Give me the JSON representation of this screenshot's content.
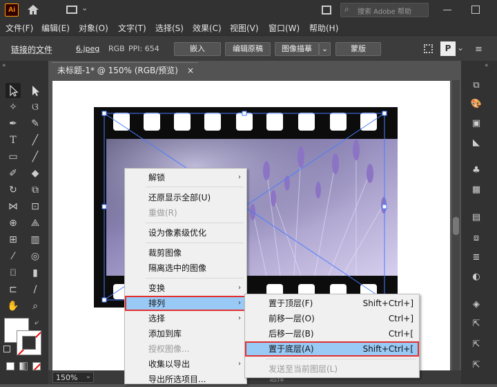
{
  "app": {
    "logo": "Ai",
    "search_placeholder": "搜索 Adobe 帮助"
  },
  "menu": [
    "文件(F)",
    "编辑(E)",
    "对象(O)",
    "文字(T)",
    "选择(S)",
    "效果(C)",
    "视图(V)",
    "窗口(W)",
    "帮助(H)"
  ],
  "control": {
    "linked_file": "链接的文件",
    "filename": "6.jpeg",
    "colormode": "RGB",
    "ppi": "PPI: 654",
    "embed": "嵌入",
    "edit_original": "编辑原稿",
    "image_trace": "图像描摹",
    "mask": "蒙版"
  },
  "document": {
    "tab_title": "未标题-1* @ 150% (RGB/预览)",
    "close": "×"
  },
  "status": {
    "zoom": "150%",
    "mode": "选择"
  },
  "context_menu": {
    "items": [
      {
        "label": "解锁",
        "submenu": true
      },
      {
        "label": "还原显示全部(U)"
      },
      {
        "label": "重做(R)",
        "disabled": true
      },
      {
        "label": "设为像素级优化"
      },
      {
        "label": "裁剪图像"
      },
      {
        "label": "隔离选中的图像"
      },
      {
        "label": "变换",
        "submenu": true
      },
      {
        "label": "排列",
        "submenu": true,
        "highlighted": true
      },
      {
        "label": "选择",
        "submenu": true
      },
      {
        "label": "添加到库"
      },
      {
        "label": "授权图像...",
        "disabled": true
      },
      {
        "label": "收集以导出",
        "submenu": true
      },
      {
        "label": "导出所选项目..."
      }
    ]
  },
  "arrange_submenu": {
    "items": [
      {
        "label": "置于顶层(F)",
        "shortcut": "Shift+Ctrl+]"
      },
      {
        "label": "前移一层(O)",
        "shortcut": "Ctrl+]"
      },
      {
        "label": "后移一层(B)",
        "shortcut": "Ctrl+["
      },
      {
        "label": "置于底层(A)",
        "shortcut": "Shift+Ctrl+[",
        "highlighted": true
      },
      {
        "label": "发送至当前图层(L)",
        "disabled": true
      }
    ]
  },
  "colors": {
    "highlight": "#99c9f5",
    "red_outline": "#e03030",
    "accent": "#ff9a00"
  }
}
